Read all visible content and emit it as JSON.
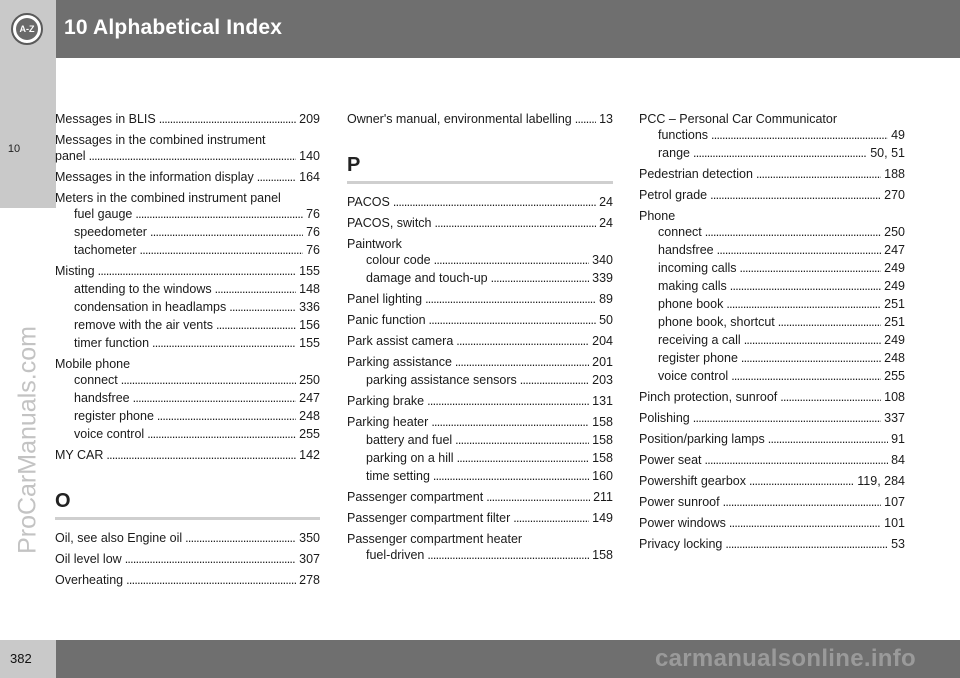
{
  "header": {
    "title": "10 Alphabetical Index",
    "icon_text": "A-Z"
  },
  "side_tab": {
    "number": "10"
  },
  "footer": {
    "page_number": "382",
    "site_watermark": "carmanualsonline.info"
  },
  "watermark": "ProCarManuals.com",
  "columns": [
    {
      "entries": [
        {
          "kind": "top",
          "text": "Messages in BLIS",
          "page": "209"
        },
        {
          "kind": "head",
          "text": "Messages in the combined instrument"
        },
        {
          "kind": "cont",
          "text": "panel",
          "page": "140"
        },
        {
          "kind": "top",
          "text": "Messages in the information display",
          "page": "164"
        },
        {
          "kind": "head",
          "text": "Meters in the combined instrument panel"
        },
        {
          "kind": "sub",
          "text": "fuel gauge",
          "page": "76"
        },
        {
          "kind": "sub",
          "text": "speedometer",
          "page": "76"
        },
        {
          "kind": "sub",
          "text": "tachometer",
          "page": "76"
        },
        {
          "kind": "top",
          "text": "Misting",
          "page": "155"
        },
        {
          "kind": "sub",
          "text": "attending to the windows",
          "page": "148"
        },
        {
          "kind": "sub",
          "text": "condensation in headlamps",
          "page": "336"
        },
        {
          "kind": "sub",
          "text": "remove with the air vents",
          "page": "156"
        },
        {
          "kind": "sub",
          "text": "timer function",
          "page": "155"
        },
        {
          "kind": "head",
          "text": "Mobile phone"
        },
        {
          "kind": "sub",
          "text": "connect",
          "page": "250"
        },
        {
          "kind": "sub",
          "text": "handsfree",
          "page": "247"
        },
        {
          "kind": "sub",
          "text": "register phone",
          "page": "248"
        },
        {
          "kind": "sub",
          "text": "voice control",
          "page": "255"
        },
        {
          "kind": "top",
          "text": "MY CAR",
          "page": "142"
        },
        {
          "kind": "section",
          "text": "O"
        },
        {
          "kind": "top",
          "text": "Oil, see also Engine oil",
          "page": "350"
        },
        {
          "kind": "top",
          "text": "Oil level low",
          "page": "307"
        },
        {
          "kind": "top",
          "text": "Overheating",
          "page": "278"
        }
      ]
    },
    {
      "entries": [
        {
          "kind": "top",
          "text": "Owner's manual, environmental labelling",
          "page": "13"
        },
        {
          "kind": "section",
          "text": "P"
        },
        {
          "kind": "top",
          "text": "PACOS",
          "page": "24"
        },
        {
          "kind": "top",
          "text": "PACOS, switch",
          "page": "24"
        },
        {
          "kind": "head",
          "text": "Paintwork"
        },
        {
          "kind": "sub",
          "text": "colour code",
          "page": "340"
        },
        {
          "kind": "sub",
          "text": "damage and touch-up",
          "page": "339"
        },
        {
          "kind": "top",
          "text": "Panel lighting",
          "page": "89"
        },
        {
          "kind": "top",
          "text": "Panic function",
          "page": "50"
        },
        {
          "kind": "top",
          "text": "Park assist camera",
          "page": "204"
        },
        {
          "kind": "top",
          "text": "Parking assistance",
          "page": "201"
        },
        {
          "kind": "sub",
          "text": "parking assistance sensors",
          "page": "203"
        },
        {
          "kind": "top",
          "text": "Parking brake",
          "page": "131"
        },
        {
          "kind": "top",
          "text": "Parking heater",
          "page": "158"
        },
        {
          "kind": "sub",
          "text": "battery and fuel",
          "page": "158"
        },
        {
          "kind": "sub",
          "text": "parking on a hill",
          "page": "158"
        },
        {
          "kind": "sub",
          "text": "time setting",
          "page": "160"
        },
        {
          "kind": "top",
          "text": "Passenger compartment",
          "page": "211"
        },
        {
          "kind": "top",
          "text": "Passenger compartment filter",
          "page": "149"
        },
        {
          "kind": "head",
          "text": "Passenger compartment heater"
        },
        {
          "kind": "sub",
          "text": "fuel-driven",
          "page": "158"
        }
      ]
    },
    {
      "entries": [
        {
          "kind": "head",
          "text": "PCC – Personal Car Communicator"
        },
        {
          "kind": "sub",
          "text": "functions",
          "page": "49"
        },
        {
          "kind": "sub",
          "text": "range",
          "page": "50, 51"
        },
        {
          "kind": "top",
          "text": "Pedestrian detection",
          "page": "188"
        },
        {
          "kind": "top",
          "text": "Petrol grade",
          "page": "270"
        },
        {
          "kind": "head",
          "text": "Phone"
        },
        {
          "kind": "sub",
          "text": "connect",
          "page": "250"
        },
        {
          "kind": "sub",
          "text": "handsfree",
          "page": "247"
        },
        {
          "kind": "sub",
          "text": "incoming calls",
          "page": "249"
        },
        {
          "kind": "sub",
          "text": "making calls",
          "page": "249"
        },
        {
          "kind": "sub",
          "text": "phone book",
          "page": "251"
        },
        {
          "kind": "sub",
          "text": "phone book, shortcut",
          "page": "251"
        },
        {
          "kind": "sub",
          "text": "receiving a call",
          "page": "249"
        },
        {
          "kind": "sub",
          "text": "register phone",
          "page": "248"
        },
        {
          "kind": "sub",
          "text": "voice control",
          "page": "255"
        },
        {
          "kind": "top",
          "text": "Pinch protection, sunroof",
          "page": "108"
        },
        {
          "kind": "top",
          "text": "Polishing",
          "page": "337"
        },
        {
          "kind": "top",
          "text": "Position/parking lamps",
          "page": "91"
        },
        {
          "kind": "top",
          "text": "Power seat",
          "page": "84"
        },
        {
          "kind": "top",
          "text": "Powershift gearbox",
          "page": "119, 284"
        },
        {
          "kind": "top",
          "text": "Power sunroof",
          "page": "107"
        },
        {
          "kind": "top",
          "text": "Power windows",
          "page": "101"
        },
        {
          "kind": "top",
          "text": "Privacy locking",
          "page": "53"
        }
      ]
    }
  ]
}
